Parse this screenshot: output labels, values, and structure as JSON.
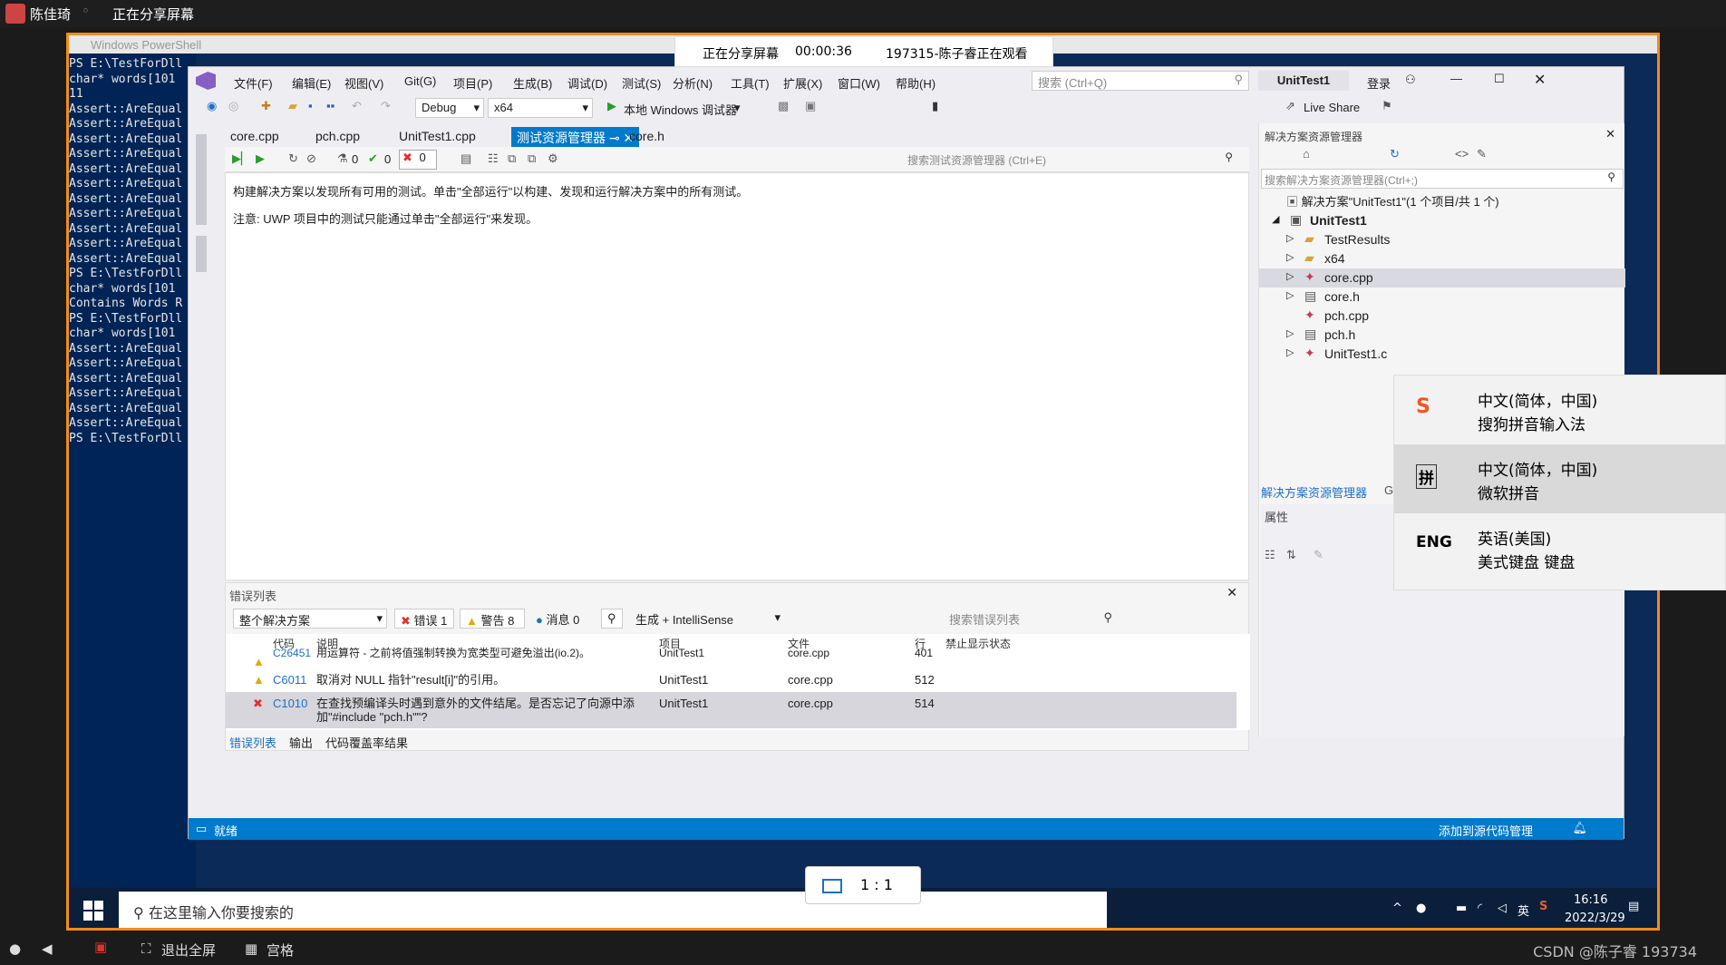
{
  "meeting": {
    "user_name": "陈佳琦",
    "sharing_status": "正在分享屏幕",
    "popup": {
      "status": "正在分享屏幕",
      "timer": "00:00:36",
      "viewer": "197315-陈子睿正在观看"
    },
    "zoom_label": "1 : 1",
    "bottom_bar": {
      "exit_fullscreen": "退出全屏",
      "grid": "宫格",
      "watermark": "CSDN @陈子睿 193734"
    }
  },
  "powershell": {
    "title": "Windows PowerShell",
    "lines": [
      "PS E:\\TestForDll",
      "char* words[101",
      "11",
      "Assert::AreEqual",
      "Assert::AreEqual",
      "Assert::AreEqual",
      "Assert::AreEqual",
      "Assert::AreEqual",
      "Assert::AreEqual",
      "Assert::AreEqual",
      "Assert::AreEqual",
      "Assert::AreEqual",
      "Assert::AreEqual",
      "Assert::AreEqual",
      "PS E:\\TestForDll",
      "char* words[101",
      "Contains Words R",
      "PS E:\\TestForDll",
      "char* words[101",
      "Assert::AreEqual",
      "Assert::AreEqual",
      "Assert::AreEqual",
      "Assert::AreEqual",
      "Assert::AreEqual",
      "Assert::AreEqual",
      "PS E:\\TestForDll"
    ]
  },
  "vs": {
    "menus": [
      "文件(F)",
      "编辑(E)",
      "视图(V)",
      "Git(G)",
      "项目(P)",
      "生成(B)",
      "调试(D)",
      "测试(S)",
      "分析(N)",
      "工具(T)",
      "扩展(X)",
      "窗口(W)",
      "帮助(H)"
    ],
    "search_placeholder": "搜索 (Ctrl+Q)",
    "project_name": "UnitTest1",
    "login": "登录",
    "live_share": "Live Share",
    "config": "Debug",
    "platform": "x64",
    "run_target": "本地 Windows 调试器",
    "tabs": [
      "core.cpp",
      "pch.cpp",
      "UnitTest1.cpp",
      "测试资源管理器",
      "core.h"
    ],
    "test_explorer": {
      "counts": {
        "flask": "0",
        "passed": "0",
        "failed": "0"
      },
      "search_placeholder": "搜索测试资源管理器 (Ctrl+E)",
      "message1": "构建解决方案以发现所有可用的测试。单击\"全部运行\"以构建、发现和运行解决方案中的所有测试。",
      "message2": "注意: UWP 项目中的测试只能通过单击\"全部运行\"来发现。"
    },
    "error_list": {
      "title": "错误列表",
      "scope": "整个解决方案",
      "errors": "错误 1",
      "warnings": "警告 8",
      "messages": "消息 0",
      "build_filter": "生成 + IntelliSense",
      "search_placeholder": "搜索错误列表",
      "columns": [
        "代码",
        "说明",
        "项目",
        "文件",
        "行",
        "禁止显示状态"
      ],
      "rows": [
        {
          "code": "C26451",
          "desc": "用运算符 - 之前将值强制转换为宽类型可避免溢出(io.2)。",
          "project": "UnitTest1",
          "file": "core.cpp",
          "line": "401",
          "severity": "warning"
        },
        {
          "code": "C6011",
          "desc": "取消对 NULL 指针\"result[i]\"的引用。",
          "project": "UnitTest1",
          "file": "core.cpp",
          "line": "512",
          "severity": "warning"
        },
        {
          "code": "C1010",
          "desc": "在查找预编译头时遇到意外的文件结尾。是否忘记了向源中添加\"#include \"pch.h\"\"?",
          "project": "UnitTest1",
          "file": "core.cpp",
          "line": "514",
          "severity": "error"
        }
      ],
      "bottom_tabs": [
        "错误列表",
        "输出",
        "代码覆盖率结果"
      ]
    },
    "solution_explorer": {
      "title": "解决方案资源管理器",
      "search_placeholder": "搜索解决方案资源管理器(Ctrl+;)",
      "solution_line": "解决方案\"UnitTest1\"(1 个项目/共 1 个)",
      "items": [
        "UnitTest1",
        "TestResults",
        "x64",
        "core.cpp",
        "core.h",
        "pch.cpp",
        "pch.h",
        "UnitTest1.c"
      ],
      "bottom_tab": "解决方案资源管理器",
      "bottom_tab2": "G",
      "properties_title": "属性"
    },
    "status": {
      "left": "就绪",
      "right": "添加到源代码管理"
    }
  },
  "ime_menu": [
    {
      "glyph": "S",
      "lang": "中文(简体，中国)",
      "name": "搜狗拼音输入法"
    },
    {
      "glyph": "拼",
      "lang": "中文(简体，中国)",
      "name": "微软拼音"
    },
    {
      "glyph": "ENG",
      "lang": "英语(美国)",
      "name": "美式键盘 键盘"
    }
  ],
  "taskbar": {
    "search_placeholder": "在这里输入你要搜索的",
    "time": "16:16",
    "date": "2022/3/29",
    "tray_lang": "英"
  },
  "colors": {
    "accent": "#007acc",
    "share_border": "#f28c1a",
    "ps_bg": "#012456"
  }
}
